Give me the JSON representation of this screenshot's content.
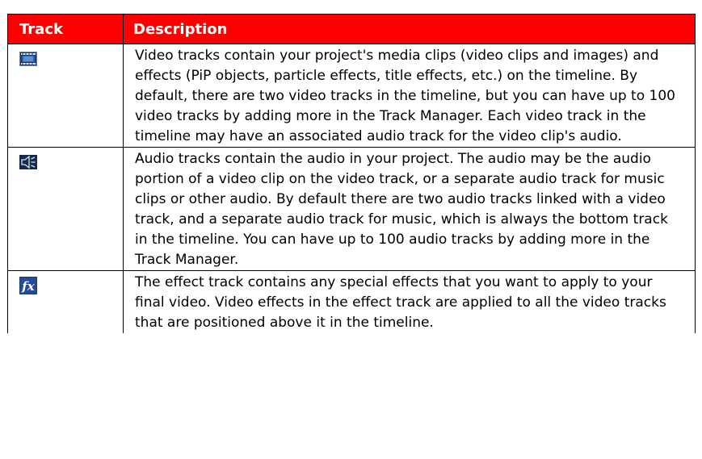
{
  "header": {
    "track": "Track",
    "description": "Description"
  },
  "rows": [
    {
      "icon": "video-track-icon",
      "description": "Video tracks contain your project's media clips (video clips and images) and effects (PiP objects, particle effects, title effects, etc.) on the timeline. By default, there are two video tracks in the timeline, but you can have up to 100 video tracks by adding more in the Track Manager. Each video track in the timeline may have an associated audio track for the video clip's audio."
    },
    {
      "icon": "audio-track-icon",
      "description": "Audio tracks contain the audio in your project. The audio may be the audio portion of a video clip on the video track, or a separate audio track for music clips or other audio. By default there are two audio tracks linked with a video track, and a separate audio track for music, which is always the bottom track in the timeline. You can have up to 100 audio tracks by adding more in the Track Manager."
    },
    {
      "icon": "effect-track-icon",
      "description": "The effect track contains any special effects that you want to apply to your final video. Video effects in the effect track are applied to all the video tracks that are positioned above it in the timeline."
    }
  ],
  "colors": {
    "header_background": "#ff0000",
    "header_text": "#ffffff",
    "border": "#000000"
  }
}
